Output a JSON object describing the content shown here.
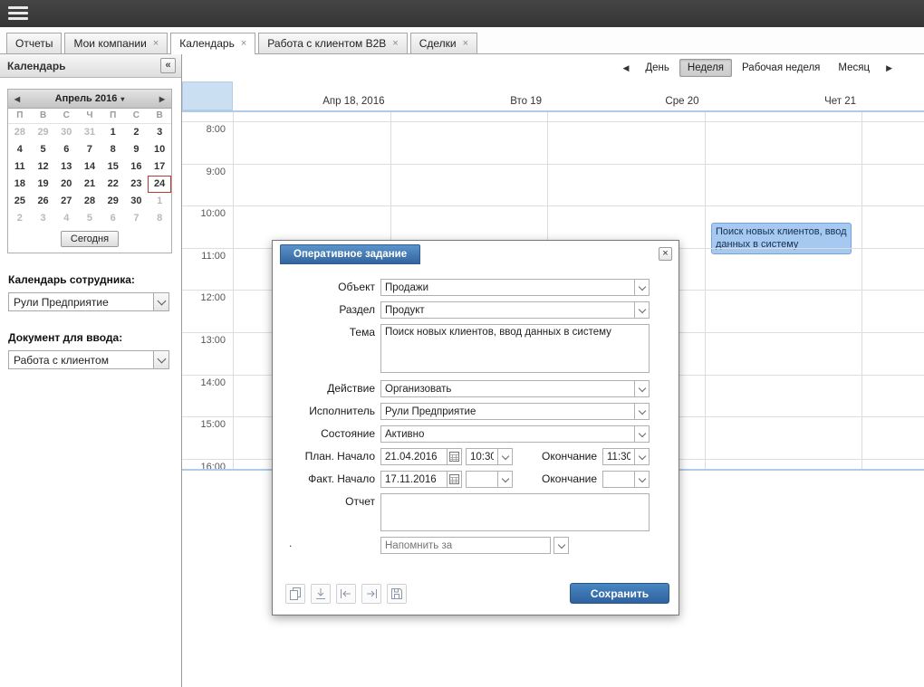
{
  "topbar": {
    "menu_icon": "hamburger-menu-icon"
  },
  "tabs": {
    "items": [
      {
        "label": "Отчеты",
        "closable": false,
        "active": false
      },
      {
        "label": "Мои компании",
        "closable": true,
        "active": false
      },
      {
        "label": "Календарь",
        "closable": true,
        "active": true
      },
      {
        "label": "Работа с клиентом B2B",
        "closable": true,
        "active": false
      },
      {
        "label": "Сделки",
        "closable": true,
        "active": false
      }
    ],
    "close_glyph": "×"
  },
  "sidebar": {
    "title": "Календарь",
    "collapse_glyph": "«",
    "mini_calendar": {
      "prev_glyph": "◀",
      "next_glyph": "▶",
      "month_label": "Апрель 2016",
      "weekdays": [
        "П",
        "В",
        "С",
        "Ч",
        "П",
        "С",
        "В"
      ],
      "weeks": [
        [
          {
            "d": 28,
            "out": true
          },
          {
            "d": 29,
            "out": true
          },
          {
            "d": 30,
            "out": true
          },
          {
            "d": 31,
            "out": true
          },
          {
            "d": 1
          },
          {
            "d": 2
          },
          {
            "d": 3
          }
        ],
        [
          {
            "d": 4
          },
          {
            "d": 5
          },
          {
            "d": 6
          },
          {
            "d": 7
          },
          {
            "d": 8
          },
          {
            "d": 9
          },
          {
            "d": 10
          }
        ],
        [
          {
            "d": 11
          },
          {
            "d": 12
          },
          {
            "d": 13
          },
          {
            "d": 14
          },
          {
            "d": 15
          },
          {
            "d": 16
          },
          {
            "d": 17
          }
        ],
        [
          {
            "d": 18
          },
          {
            "d": 19
          },
          {
            "d": 20
          },
          {
            "d": 21
          },
          {
            "d": 22
          },
          {
            "d": 23
          },
          {
            "d": 24,
            "selected": true
          }
        ],
        [
          {
            "d": 25
          },
          {
            "d": 26
          },
          {
            "d": 27
          },
          {
            "d": 28
          },
          {
            "d": 29
          },
          {
            "d": 30
          },
          {
            "d": 1,
            "out": true
          }
        ],
        [
          {
            "d": 2,
            "out": true
          },
          {
            "d": 3,
            "out": true
          },
          {
            "d": 4,
            "out": true
          },
          {
            "d": 5,
            "out": true
          },
          {
            "d": 6,
            "out": true
          },
          {
            "d": 7,
            "out": true
          },
          {
            "d": 8,
            "out": true
          }
        ]
      ],
      "today_button": "Сегодня"
    },
    "employee": {
      "label": "Календарь сотрудника:",
      "value": "Рули Предприятие"
    },
    "document": {
      "label": "Документ для ввода:",
      "value": "Работа с клиентом"
    }
  },
  "scheduler": {
    "prev_glyph": "◀",
    "next_glyph": "▶",
    "views": [
      {
        "label": "День",
        "active": false
      },
      {
        "label": "Неделя",
        "active": true
      },
      {
        "label": "Рабочая неделя",
        "active": false
      },
      {
        "label": "Месяц",
        "active": false
      }
    ],
    "day_headers": [
      "Апр 18, 2016",
      "Вто 19",
      "Сре 20",
      "Чет 21"
    ],
    "times": [
      "8:00",
      "9:00",
      "10:00",
      "11:00",
      "12:00",
      "13:00",
      "14:00",
      "15:00",
      "16:00"
    ],
    "event": {
      "text": "Поиск новых клиентов, ввод данных в систему"
    }
  },
  "dialog": {
    "title": "Оперативное задание",
    "close_glyph": "×",
    "rows": {
      "object": {
        "label": "Объект",
        "value": "Продажи"
      },
      "section": {
        "label": "Раздел",
        "value": "Продукт"
      },
      "theme": {
        "label": "Тема",
        "value": "Поиск новых клиентов, ввод данных в систему"
      },
      "action": {
        "label": "Действие",
        "value": "Организовать"
      },
      "executor": {
        "label": "Исполнитель",
        "value": "Рули Предприятие"
      },
      "state": {
        "label": "Состояние",
        "value": "Активно"
      },
      "plan": {
        "label": "План. Начало",
        "date": "21.04.2016",
        "time": "10:30",
        "end_label": "Окончание",
        "end_time": "11:30"
      },
      "fact": {
        "label": "Факт. Начало",
        "date": "17.11.2016",
        "time": "",
        "end_label": "Окончание",
        "end_time": ""
      },
      "report": {
        "label": "Отчет",
        "value": ""
      },
      "remind": {
        "left_dot": ".",
        "placeholder": "Напомнить за"
      }
    },
    "save_button": "Сохранить"
  }
}
